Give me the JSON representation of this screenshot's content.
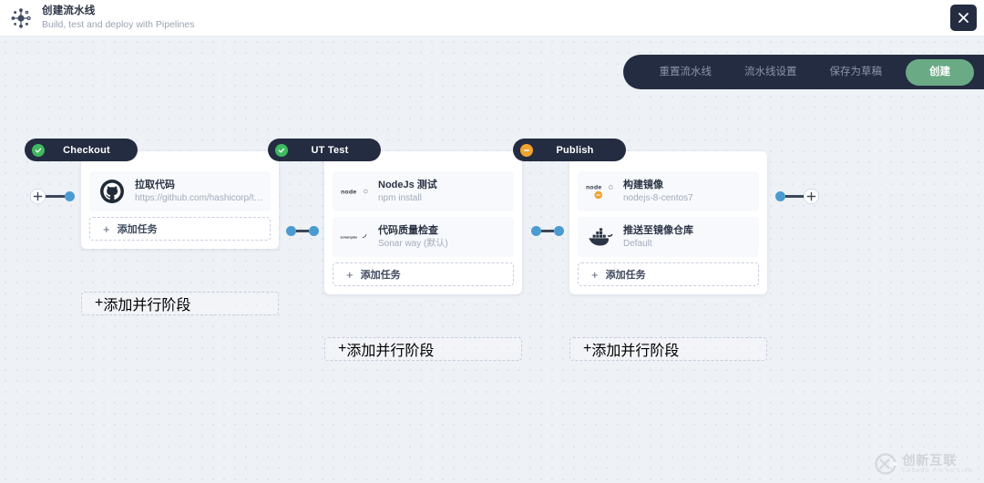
{
  "header": {
    "title": "创建流水线",
    "subtitle": "Build, test and deploy with Pipelines",
    "logo_icon": "pipeline-node-icon",
    "close_icon": "close-icon"
  },
  "toolbar": {
    "reset_label": "重置流水线",
    "settings_label": "流水线设置",
    "draft_label": "保存为草稿",
    "create_label": "创建",
    "accent_color": "#6aab86",
    "background_color": "#242c41"
  },
  "canvas": {
    "background_color": "#eef1f6",
    "dot_color": "#dfe4ec"
  },
  "connectors": {
    "left": {
      "plus_label": "+",
      "icon": "add-stage-icon"
    },
    "right": {
      "plus_label": "+",
      "icon": "add-stage-icon"
    }
  },
  "stages": [
    {
      "name": "Checkout",
      "status": "success",
      "status_color": "#3fb95f",
      "status_icon": "check-circle-icon",
      "add_task_label": "添加任务",
      "add_parallel_label": "添加并行阶段",
      "tasks": [
        {
          "title": "拉取代码",
          "subtitle": "https://github.com/hashicorp/ter...",
          "icon": "github-icon",
          "badge": null
        }
      ]
    },
    {
      "name": "UT Test",
      "status": "success",
      "status_color": "#3fb95f",
      "status_icon": "check-circle-icon",
      "add_task_label": "添加任务",
      "add_parallel_label": "添加并行阶段",
      "tasks": [
        {
          "title": "NodeJs 测试",
          "subtitle": "npm install",
          "icon": "nodejs-icon",
          "badge": null
        },
        {
          "title": "代码质量检查",
          "subtitle": "Sonar way (默认)",
          "icon": "sonarqube-icon",
          "badge": null
        }
      ]
    },
    {
      "name": "Publish",
      "status": "warning",
      "status_color": "#f0a32e",
      "status_icon": "minus-circle-icon",
      "add_task_label": "添加任务",
      "add_parallel_label": "添加并行阶段",
      "tasks": [
        {
          "title": "构建镜像",
          "subtitle": "nodejs-8-centos7",
          "icon": "nodejs-icon",
          "badge": "minus-circle-warning-icon"
        },
        {
          "title": "推送至镜像仓库",
          "subtitle": "Default",
          "icon": "docker-icon",
          "badge": null
        }
      ]
    }
  ],
  "watermark": {
    "main": "创新互联",
    "sub": "CHUANG XIN HU LIAN",
    "icon": "cx-logo-icon"
  }
}
